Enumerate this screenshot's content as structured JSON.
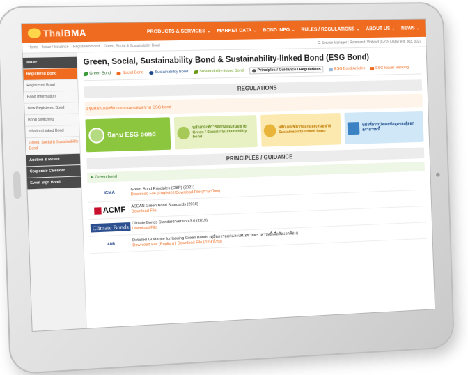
{
  "brand": {
    "logo_prefix": "Thai",
    "logo_main": "BMA",
    "accent": "#ef6b1f"
  },
  "nav": [
    "PRODUCTS & SERVICES ⌄",
    "MARKET DATA ⌄",
    "BOND INFO ⌄",
    "RULES / REGULATIONS ⌄",
    "ABOUT US ⌄",
    "NEWS ⌄"
  ],
  "breadcrumb": [
    "Home",
    "Issue / Issuance",
    "Registered Bond",
    "Green, Social & Sustainability Bond"
  ],
  "account": "☰ Service Manager : Rommand, Vibhavd (0-2257-0357 ext. 303, 302)",
  "sidebar": [
    {
      "label": "Issuer",
      "style": "dark"
    },
    {
      "label": "Registered Bond",
      "style": "orange"
    },
    {
      "label": "Registered Bond",
      "style": "normal"
    },
    {
      "label": "Bond Information",
      "style": "normal"
    },
    {
      "label": "New Registered Bond",
      "style": "normal"
    },
    {
      "label": "Bond Switching",
      "style": "normal"
    },
    {
      "label": "Inflation-Linked Bond",
      "style": "normal"
    },
    {
      "label": "Green, Social & Sustainability Bond",
      "style": "active"
    },
    {
      "label": "Auction & Result",
      "style": "dark"
    },
    {
      "label": "Corporate Calendar",
      "style": "dark"
    },
    {
      "label": "Event Sign Bond",
      "style": "dark"
    }
  ],
  "page_title": "Green, Social, Sustainability Bond & Sustainability-linked Bond (ESG Bond)",
  "tabs": [
    {
      "label": "Green Bond",
      "color": "green"
    },
    {
      "label": "Social Bond",
      "color": "orange"
    },
    {
      "label": "Sustainability Bond",
      "color": "blue"
    },
    {
      "label": "Sustainability-linked Bond",
      "color": "lime"
    },
    {
      "label": "Principles / Guidance / Regulations",
      "color": "active"
    },
    {
      "label": "ESG Bond Articles",
      "color": "orange"
    },
    {
      "label": "ESG Issuer Ranking",
      "color": "orange"
    }
  ],
  "regulations_header": "REGULATIONS",
  "thai_note": "สรุปหลักเกณฑ์การออกและเสนอขาย ESG bond",
  "cards": [
    {
      "text": "นิยาม ESG bond"
    },
    {
      "text": "หลักเกณฑ์การออกและเสนอขาย Green / Social / Sustainability bond"
    },
    {
      "text": "หลักเกณฑ์การออกและเสนอขาย Sustainability-linked bond"
    },
    {
      "text": "หน้าที่การเปิดเผยข้อมูลของผู้ออกตราสารหนี้"
    }
  ],
  "principles_header": "PRINCIPLES / GUIDANCE",
  "green_bond_subhead": "☙ Green bond",
  "documents": [
    {
      "logo": "ICMA",
      "title": "Green Bond Principles (GBP) (2021)",
      "links": "Download File (English) | Download File (ภาษาไทย)"
    },
    {
      "logo": "ACMF",
      "title": "ASEAN Green Bond Standards (2018)",
      "links": "Download File"
    },
    {
      "logo": "Climate Bonds",
      "title": "Climate Bonds Standard Version 3.0 (2019)",
      "links": "Download File"
    },
    {
      "logo": "ADB",
      "title": "Detailed Guidance for Issuing Green Bonds (คู่มือการออกและเสนอขายตราสารหนี้เพื่อสิ่งแวดล้อม)",
      "links": "Download File (English) | Download File (ภาษาไทย)"
    }
  ]
}
